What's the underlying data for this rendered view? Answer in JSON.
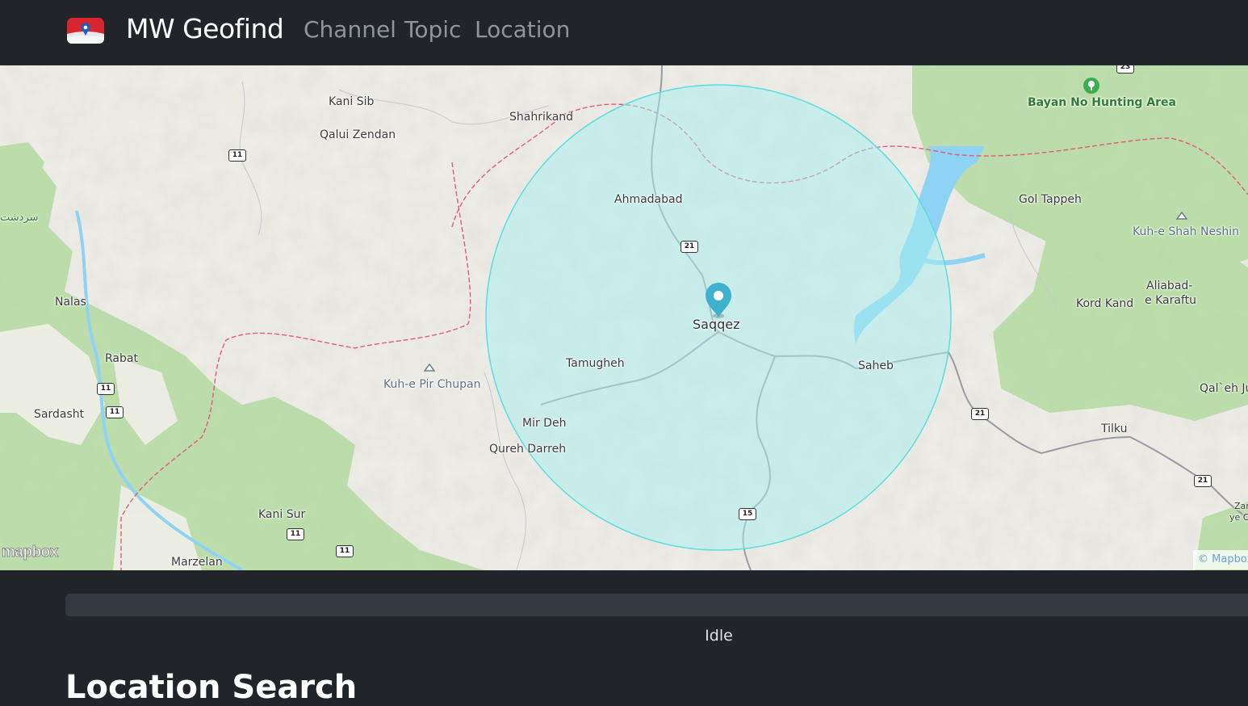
{
  "navbar": {
    "brand": "MW Geofind",
    "links": [
      {
        "label": "Channel"
      },
      {
        "label": "Topic"
      },
      {
        "label": "Location"
      }
    ]
  },
  "map": {
    "labels": {
      "kani_sib": "Kani Sib",
      "qalui_zendan": "Qalui Zendan",
      "shahrikand": "Shahrikand",
      "ahmadabad": "Ahmadabad",
      "saqqez": "Saqqez",
      "tamugheh": "Tamugheh",
      "saheb": "Saheb",
      "mir_deh": "Mir Deh",
      "qureh_darreh": "Qureh Darreh",
      "kuh_e_pir_chupan": "Kuh-e Pir Chupan",
      "nalas": "Nalas",
      "rabat": "Rabat",
      "sardasht": "Sardasht",
      "kani_sur": "Kani Sur",
      "marzelan": "Marzelan",
      "bayan_no": "Bayan No Hunting Area",
      "gol_tappeh": "Gol Tappeh",
      "kuh_e_shah_neshin": "Kuh-e Shah Neshin",
      "kord_kand": "Kord Kand",
      "aliabad_1": "Aliabad-",
      "aliabad_2": "e Karaftu",
      "qaleh": "Qal`eh Ju",
      "tilku": "Tilku",
      "persian": "سردشت",
      "zar_1": "Zar",
      "zar_2": "ye O"
    },
    "road_shields": [
      "11",
      "11",
      "11",
      "11",
      "11",
      "21",
      "21",
      "21",
      "15",
      "23"
    ],
    "logo": "mapbox",
    "attribution": "© Mapbox",
    "search_radius_fill": "#a6f0f0",
    "marker_color": "#3fb1ce"
  },
  "progress": {
    "value": 0
  },
  "status": "Idle",
  "section": {
    "title": "Location Search"
  }
}
